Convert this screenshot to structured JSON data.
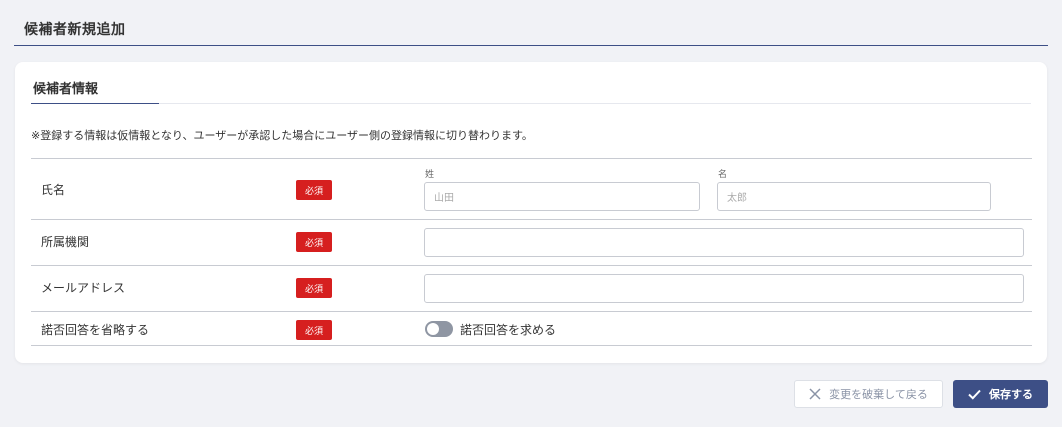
{
  "page": {
    "title": "候補者新規追加"
  },
  "section": {
    "title": "候補者情報",
    "note": "※登録する情報は仮情報となり、ユーザーが承認した場合にユーザー側の登録情報に切り替わります。"
  },
  "form": {
    "required_label": "必須",
    "name": {
      "label": "氏名",
      "last_name_label": "姓",
      "last_name_placeholder": "山田",
      "first_name_label": "名",
      "first_name_placeholder": "太郎"
    },
    "organization": {
      "label": "所属機関",
      "value": ""
    },
    "email": {
      "label": "メールアドレス",
      "value": ""
    },
    "skip_response": {
      "label": "諾否回答を省略する",
      "toggle_label": "諾否回答を求める",
      "toggle_on": false
    }
  },
  "buttons": {
    "discard_label": "変更を破棄して戻る",
    "save_label": "保存する"
  },
  "colors": {
    "accent": "#3d4f86",
    "required": "#d61f1f",
    "toggle_off": "#8f96a3"
  }
}
